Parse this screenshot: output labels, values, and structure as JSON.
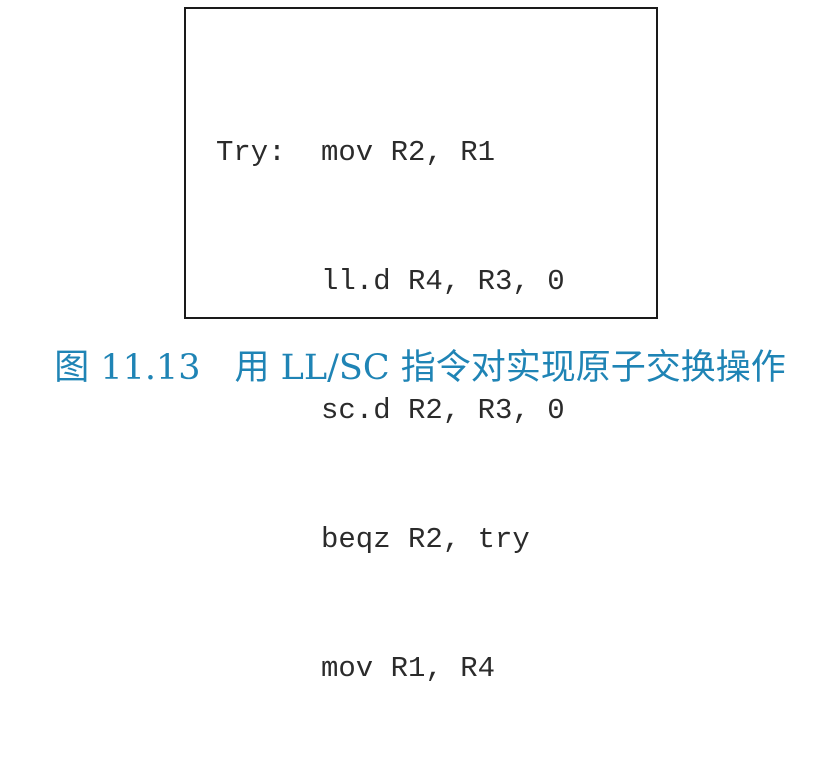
{
  "code_block": {
    "lines": [
      {
        "label": "Try:",
        "instruction": "mov R2, R1"
      },
      {
        "label": "",
        "instruction": "ll.d R4, R3, 0"
      },
      {
        "label": "",
        "instruction": "sc.d R2, R3, 0"
      },
      {
        "label": "",
        "instruction": "beqz R2, try"
      },
      {
        "label": "",
        "instruction": "mov R1, R4"
      }
    ]
  },
  "caption": {
    "number": "图 11.13",
    "text": "用 LL/SC 指令对实现原子交换操作"
  }
}
